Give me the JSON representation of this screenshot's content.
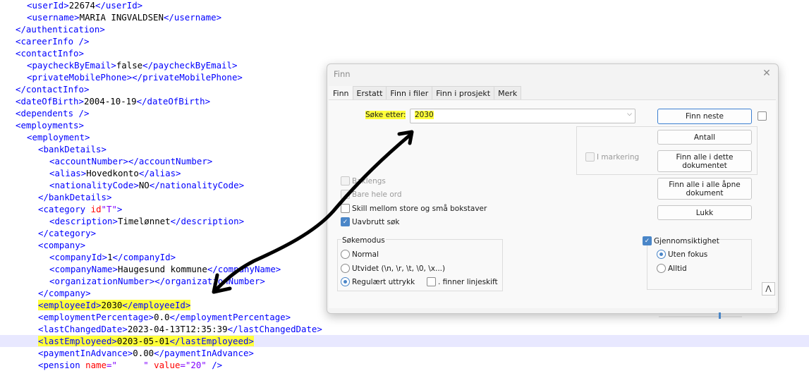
{
  "editor": {
    "lines": [
      {
        "pre": "  ",
        "tag_open": "<userId>",
        "text": "22674",
        "tag_close": "</userId>"
      },
      {
        "pre": "  ",
        "tag_open": "<username>",
        "text": "MARIA INGVALDSEN",
        "tag_close": "</username>"
      },
      {
        "pre": "",
        "tag_open": "</authentication>",
        "text": "",
        "tag_close": ""
      },
      {
        "pre": "",
        "tag_open": "<careerInfo />",
        "text": "",
        "tag_close": ""
      },
      {
        "pre": "",
        "tag_open": "<contactInfo>",
        "text": "",
        "tag_close": ""
      },
      {
        "pre": "  ",
        "tag_open": "<paycheckByEmail>",
        "text": "false",
        "tag_close": "</paycheckByEmail>"
      },
      {
        "pre": "  ",
        "tag_open": "<privateMobilePhone>",
        "text": "",
        "tag_close": "</privateMobilePhone>"
      },
      {
        "pre": "",
        "tag_open": "</contactInfo>",
        "text": "",
        "tag_close": ""
      },
      {
        "pre": "",
        "tag_open": "<dateOfBirth>",
        "text": "2004-10-19",
        "tag_close": "</dateOfBirth>"
      },
      {
        "pre": "",
        "tag_open": "<dependents />",
        "text": "",
        "tag_close": ""
      },
      {
        "pre": "",
        "tag_open": "<employments>",
        "text": "",
        "tag_close": ""
      },
      {
        "pre": "  ",
        "tag_open": "<employment>",
        "text": "",
        "tag_close": ""
      },
      {
        "pre": "    ",
        "tag_open": "<bankDetails>",
        "text": "",
        "tag_close": ""
      },
      {
        "pre": "      ",
        "tag_open": "<accountNumber>",
        "text": "",
        "tag_close": "</accountNumber>"
      },
      {
        "pre": "      ",
        "tag_open": "<alias>",
        "text": "Hovedkonto",
        "tag_close": "</alias>"
      },
      {
        "pre": "      ",
        "tag_open": "<nationalityCode>",
        "text": "NO",
        "tag_close": "</nationalityCode>"
      },
      {
        "pre": "    ",
        "tag_open": "</bankDetails>",
        "text": "",
        "tag_close": ""
      },
      {
        "pre": "    ",
        "tag_open": "<category ",
        "attr": "id",
        "attrval": "\"T\"",
        "tag_end": ">",
        "text": "",
        "tag_close": ""
      },
      {
        "pre": "      ",
        "tag_open": "<description>",
        "text": "Timelønnet",
        "tag_close": "</description>"
      },
      {
        "pre": "    ",
        "tag_open": "</category>",
        "text": "",
        "tag_close": ""
      },
      {
        "pre": "    ",
        "tag_open": "<company>",
        "text": "",
        "tag_close": ""
      },
      {
        "pre": "      ",
        "tag_open": "<companyId>",
        "text": "1",
        "tag_close": "</companyId>"
      },
      {
        "pre": "      ",
        "tag_open": "<companyName>",
        "text": "Haugesund kommune",
        "tag_close": "</companyName>"
      },
      {
        "pre": "      ",
        "tag_open": "<organizationNumber>",
        "text": "",
        "tag_close": "</organizationNumber>"
      },
      {
        "pre": "    ",
        "tag_open": "</company>",
        "text": "",
        "tag_close": ""
      },
      {
        "pre": "    ",
        "tag_open": "<employeeId>",
        "text": "2030",
        "tag_close": "</employeeId>",
        "highlight": true
      },
      {
        "pre": "    ",
        "tag_open": "<employmentPercentage>",
        "text": "0.0",
        "tag_close": "</employmentPercentage>"
      },
      {
        "pre": "    ",
        "tag_open": "<lastChangedDate>",
        "text": "2023-04-13T12:35:39",
        "tag_close": "</lastChangedDate>"
      },
      {
        "pre": "    ",
        "tag_open": "<lastEmployeed>",
        "text": "0203-05-01",
        "tag_close": "</lastEmployeed>",
        "highlight": true,
        "current": true
      },
      {
        "pre": "    ",
        "tag_open": "<paymentInAdvance>",
        "text": "0.00",
        "tag_close": "</paymentInAdvance>"
      },
      {
        "pre": "    ",
        "tag_open": "<pension ",
        "attr": "name",
        "attrval": "=\"     \"",
        "attr2": " value",
        "attrval2": "=\"20\"",
        "tag_end": " />",
        "text": "",
        "tag_close": ""
      }
    ]
  },
  "dialog": {
    "title": "Finn",
    "tabs": [
      "Finn",
      "Erstatt",
      "Finn i filer",
      "Finn i prosjekt",
      "Merk"
    ],
    "search_label": "Søke etter:",
    "search_value": "2030",
    "buttons": {
      "find_next": "Finn neste",
      "count": "Antall",
      "find_all_doc": "Finn alle i dette dokumentet",
      "find_all_open": "Finn alle i alle åpne dokument",
      "close": "Lukk"
    },
    "in_selection": "I markering",
    "options": {
      "backward": "Baklengs",
      "whole_word": "Bare hele ord",
      "match_case": "Skill mellom store og små bokstaver",
      "wrap": "Uavbrutt søk"
    },
    "search_mode": {
      "title": "Søkemodus",
      "normal": "Normal",
      "extended": "Utvidet (\\n, \\r, \\t, \\0, \\x...)",
      "regex": "Regulært uttrykk",
      "dot_newline": ". finner linjeskift"
    },
    "transparency": {
      "title": "Gjennomsiktighet",
      "on_lose_focus": "Uten fokus",
      "always": "Alltid",
      "level": 0.72
    }
  }
}
